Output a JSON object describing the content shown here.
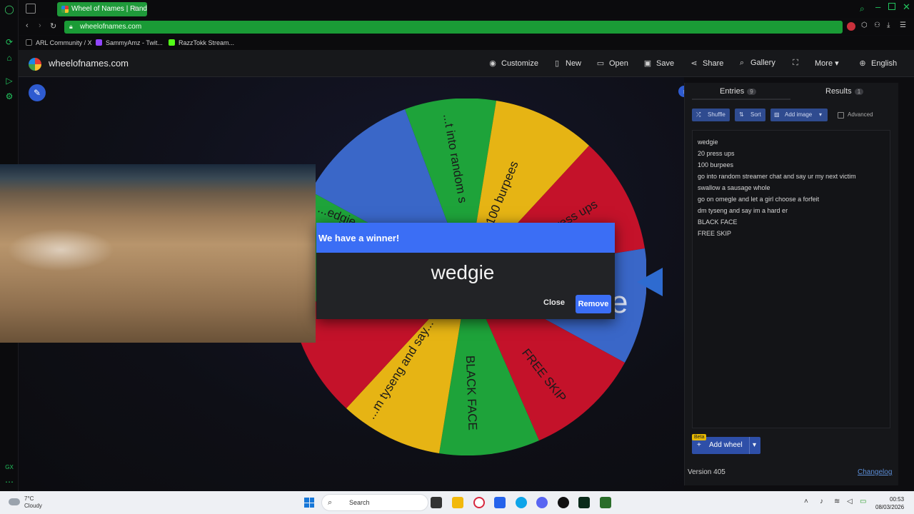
{
  "browser": {
    "tab_title": "Wheel of Names | Random",
    "url": "wheelofnames.com",
    "bookmarks": [
      {
        "label": "ARL Community / X"
      },
      {
        "label": "SammyAmz - Twit..."
      },
      {
        "label": "RazzTokk Stream..."
      }
    ]
  },
  "site": {
    "name": "wheelofnames.com",
    "nav": {
      "customize": "Customize",
      "new": "New",
      "open": "Open",
      "save": "Save",
      "share": "Share",
      "gallery": "Gallery",
      "more": "More",
      "language": "English"
    }
  },
  "wheel": {
    "visible_labels": [
      "...t into random s",
      "100 burpees",
      "...press ups",
      "...edgie",
      "e",
      "...m tyseng and say...",
      "BLACK FACE",
      "FREE SKIP"
    ],
    "colors": {
      "green": "#1ea33a",
      "yellow": "#e6b414",
      "red": "#c4122a",
      "blue": "#3a67c8"
    }
  },
  "modal": {
    "title": "We have a winner!",
    "winner": "wedgie",
    "close_label": "Close",
    "remove_label": "Remove"
  },
  "panel": {
    "tab_entries": "Entries",
    "entries_count": "9",
    "tab_results": "Results",
    "results_count": "1",
    "shuffle": "Shuffle",
    "sort": "Sort",
    "add_image": "Add image",
    "advanced": "Advanced",
    "entries": [
      "wedgie",
      "20 press ups",
      "100 burpees",
      "go into random streamer chat and say ur my next victim",
      "swallow a sausage whole",
      "go on omegle and let a girl choose a forfeit",
      "dm tyseng and say im a hard er",
      "BLACK FACE",
      "FREE SKIP"
    ],
    "beta": "Beta",
    "add_wheel": "Add wheel",
    "version": "Version 405",
    "changelog": "Changelog"
  },
  "taskbar": {
    "weather_temp": "7°C",
    "weather_desc": "Cloudy",
    "search_placeholder": "Search",
    "time": "00:53",
    "date": "08/03/2026"
  }
}
